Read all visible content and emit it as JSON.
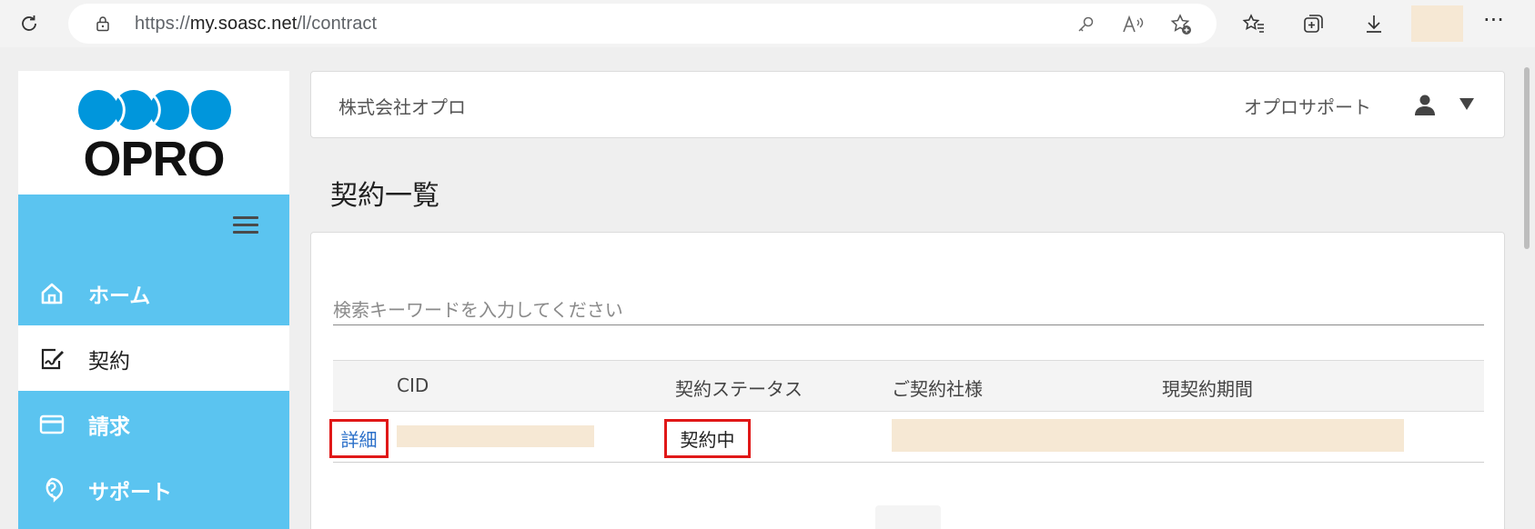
{
  "browser": {
    "url_prefix": "https://",
    "url_host": "my.soasc.net",
    "url_path": "/l/contract"
  },
  "sidebar": {
    "logo_text": "OPRO",
    "items": [
      {
        "label": "ホーム",
        "icon": "home-icon"
      },
      {
        "label": "契約",
        "icon": "contract-sign-icon"
      },
      {
        "label": "請求",
        "icon": "credit-card-icon"
      },
      {
        "label": "サポート",
        "icon": "help-icon"
      }
    ]
  },
  "header": {
    "company": "株式会社オプロ",
    "user_name": "オプロサポート"
  },
  "page": {
    "title": "契約一覧",
    "search_placeholder": "検索キーワードを入力してください"
  },
  "table": {
    "columns": [
      "CID",
      "契約ステータス",
      "ご契約社様",
      "現契約期間"
    ],
    "rows": [
      {
        "action": "詳細",
        "status": "契約中"
      }
    ]
  },
  "colors": {
    "sidebar": "#5bc4f0",
    "logo_blue": "#0096dc",
    "highlight_red": "#e01818",
    "link": "#2a6fc9",
    "mask": "#f6e8d4"
  }
}
